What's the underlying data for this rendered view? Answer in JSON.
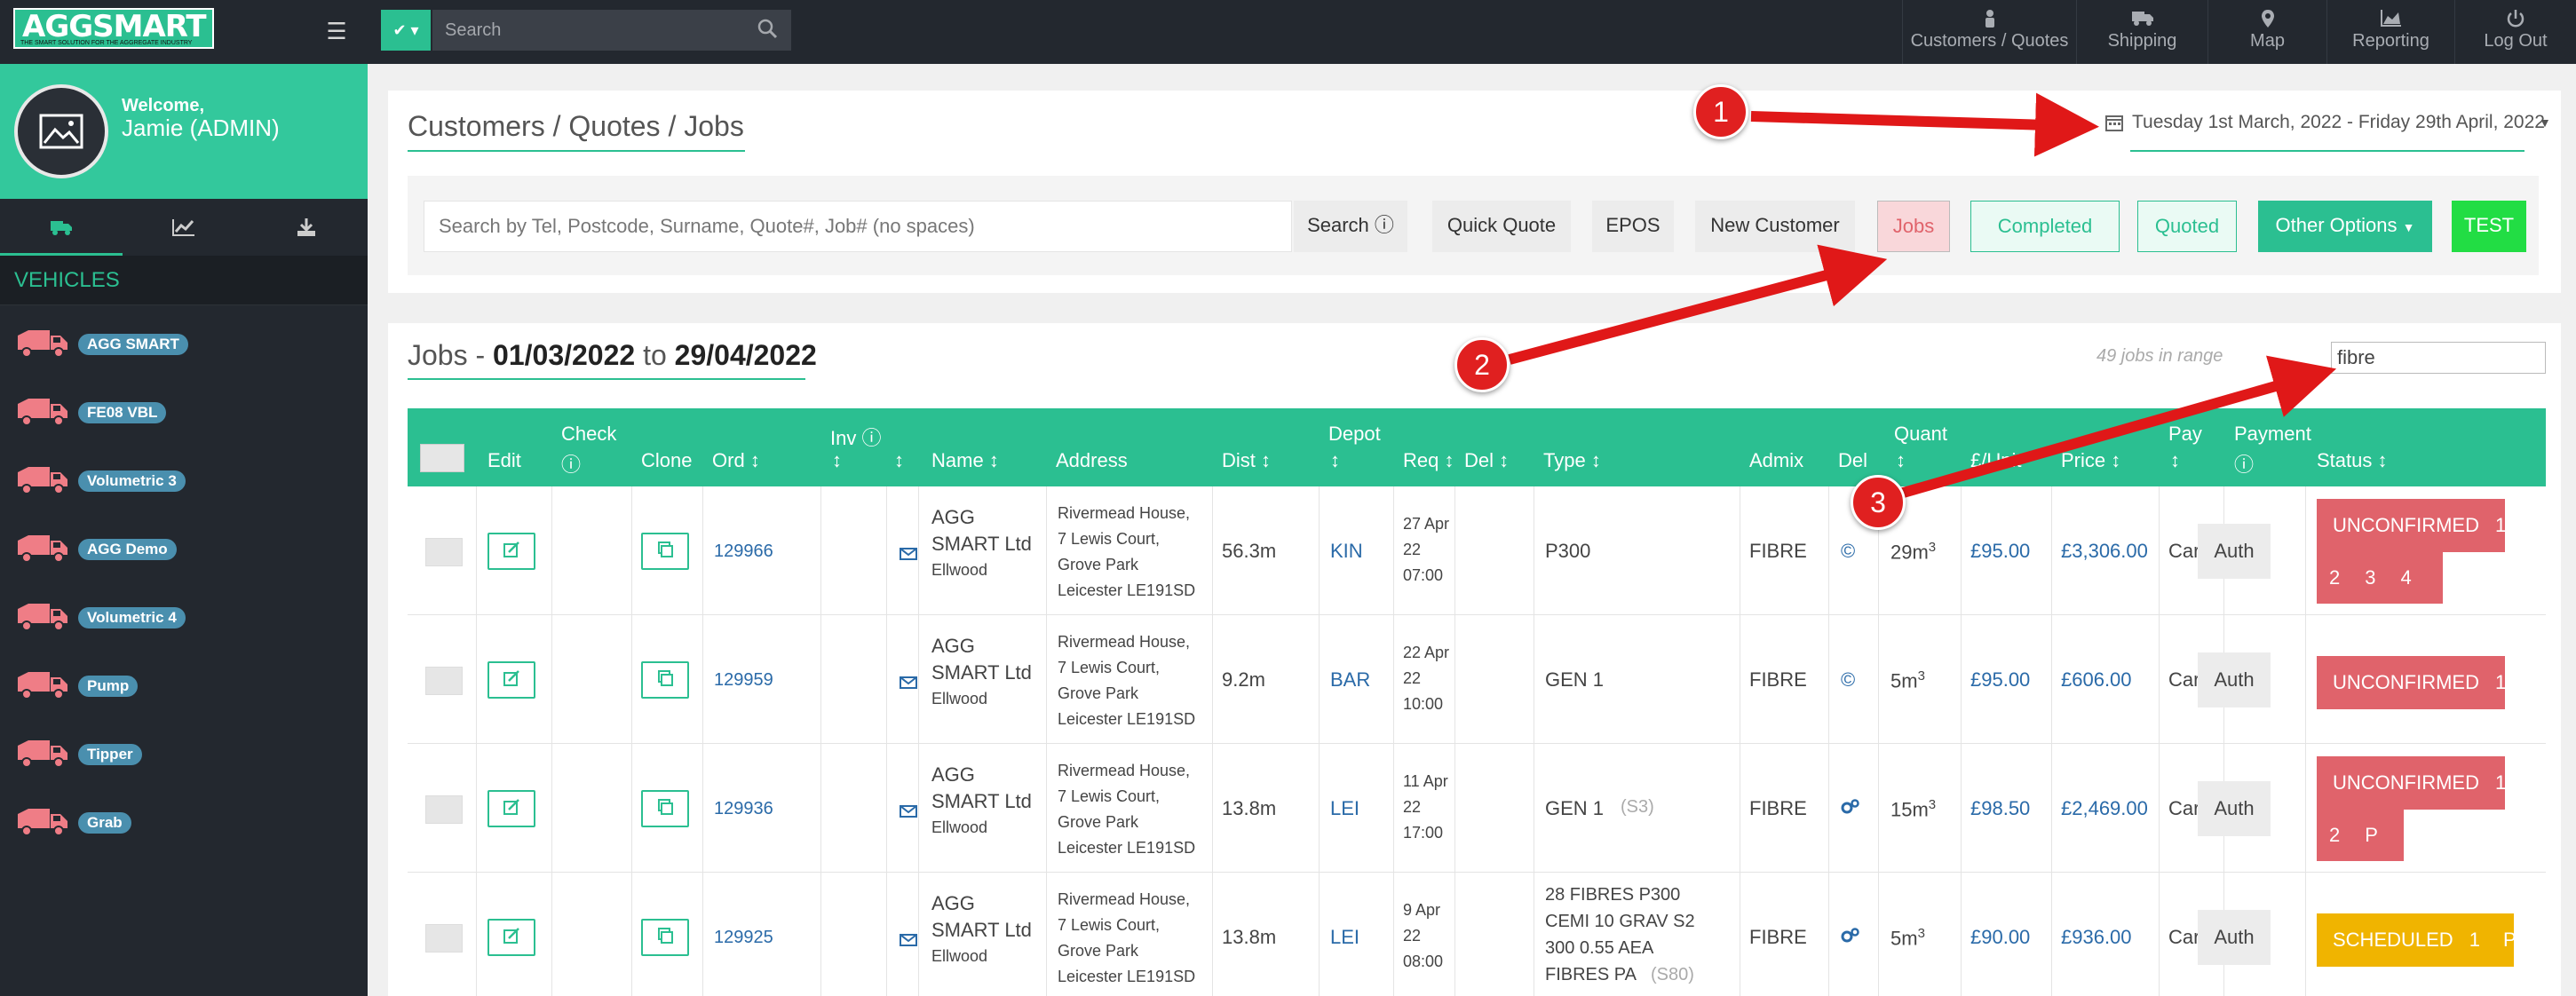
{
  "header": {
    "logo_text": "AGGSMART",
    "logo_tagline": "THE SMART SOLUTION FOR THE AGGREGATE INDUSTRY",
    "search_placeholder": "Search",
    "nav": [
      {
        "label": "Customers / Quotes",
        "icon": "person-icon"
      },
      {
        "label": "Shipping",
        "icon": "truck-icon"
      },
      {
        "label": "Map",
        "icon": "map-pin-icon"
      },
      {
        "label": "Reporting",
        "icon": "area-chart-icon"
      },
      {
        "label": "Log Out",
        "icon": "power-icon"
      }
    ]
  },
  "sidebar": {
    "welcome": "Welcome,",
    "user": "Jamie (ADMIN)",
    "section_title": "VEHICLES",
    "vehicles": [
      "AGG SMART",
      "FE08 VBL",
      "Volumetric 3",
      "AGG Demo",
      "Volumetric 4",
      "Pump",
      "Tipper",
      "Grab"
    ]
  },
  "panel": {
    "title": "Customers / Quotes / Jobs",
    "date_range": "Tuesday 1st March, 2022 - Friday 29th April, 2022",
    "search_placeholder": "Search by Tel, Postcode, Surname, Quote#, Job# (no spaces)",
    "buttons": {
      "search": "Search",
      "quick_quote": "Quick Quote",
      "epos": "EPOS",
      "new_customer": "New Customer",
      "jobs": "Jobs",
      "completed": "Completed",
      "quoted": "Quoted",
      "other_options": "Other Options",
      "test": "TEST"
    }
  },
  "jobs": {
    "title_prefix": "Jobs - ",
    "date_from": "01/03/2022",
    "to": " to ",
    "date_to": "29/04/2022",
    "count_text": "49 jobs in range",
    "filter_value": "fibre",
    "columns": {
      "edit": "Edit",
      "check": "Check",
      "clone": "Clone",
      "ord": "Ord",
      "inv": "Inv",
      "name": "Name",
      "address": "Address",
      "dist": "Dist",
      "depot": "Depot",
      "req": "Req",
      "del": "Del",
      "type": "Type",
      "admix": "Admix",
      "del2": "Del",
      "quant": "Quant",
      "unit": "£/Unit",
      "price": "Price",
      "pay": "Pay",
      "payment": "Payment",
      "status": "Status"
    },
    "rows": [
      {
        "ord": "129966",
        "name": [
          "AGG",
          "SMART Ltd"
        ],
        "name_sub": "Ellwood",
        "address": [
          "Rivermead House,",
          "7 Lewis Court,",
          "Grove Park",
          "Leicester LE191SD"
        ],
        "dist": "56.3m",
        "depot": "KIN",
        "req": [
          "27 Apr",
          "22",
          "07:00"
        ],
        "type": [
          "P300"
        ],
        "type_note": "",
        "admix": "FIBRE",
        "quant": "29m",
        "unit": "£95.00",
        "price": "£3,306.00",
        "pay": "Card",
        "payment": "Auth",
        "status": "UNCONFIRMED",
        "status_color": "#e0636b",
        "status_row1": [
          "1"
        ],
        "status_row2": [
          "2",
          "3",
          "4"
        ]
      },
      {
        "ord": "129959",
        "name": [
          "AGG",
          "SMART Ltd"
        ],
        "name_sub": "Ellwood",
        "address": [
          "Rivermead House,",
          "7 Lewis Court,",
          "Grove Park",
          "Leicester LE191SD"
        ],
        "dist": "9.2m",
        "depot": "BAR",
        "req": [
          "22 Apr",
          "22",
          "10:00"
        ],
        "type": [
          "GEN 1"
        ],
        "type_note": "",
        "admix": "FIBRE",
        "quant": "5m",
        "unit": "£95.00",
        "price": "£606.00",
        "pay": "Card",
        "payment": "Auth",
        "status": "UNCONFIRMED",
        "status_color": "#e0636b",
        "status_row1": [
          "1"
        ],
        "status_row2": []
      },
      {
        "ord": "129936",
        "name": [
          "AGG",
          "SMART Ltd"
        ],
        "name_sub": "Ellwood",
        "address": [
          "Rivermead House,",
          "7 Lewis Court,",
          "Grove Park",
          "Leicester LE191SD"
        ],
        "dist": "13.8m",
        "depot": "LEI",
        "req": [
          "11 Apr",
          "22",
          "17:00"
        ],
        "type": [
          "GEN 1"
        ],
        "type_note": "(S3)",
        "admix": "FIBRE",
        "quant": "15m",
        "unit": "£98.50",
        "price": "£2,469.00",
        "pay": "Card",
        "payment": "Auth",
        "status": "UNCONFIRMED",
        "status_color": "#e0636b",
        "status_row1": [
          "1"
        ],
        "status_row2": [
          "2",
          "P"
        ]
      },
      {
        "ord": "129925",
        "name": [
          "AGG",
          "SMART Ltd"
        ],
        "name_sub": "Ellwood",
        "address": [
          "Rivermead House,",
          "7 Lewis Court,",
          "Grove Park",
          "Leicester LE191SD"
        ],
        "dist": "13.8m",
        "depot": "LEI",
        "req": [
          "9 Apr",
          "22",
          "08:00"
        ],
        "type": [
          "28 FIBRES P300",
          "CEMI 10 GRAV S2",
          "300 0.55 AEA",
          "FIBRES PA"
        ],
        "type_note": "(S80)",
        "admix": "FIBRE",
        "quant": "5m",
        "unit": "£90.00",
        "price": "£936.00",
        "pay": "Card",
        "payment": "Auth",
        "status": "SCHEDULED",
        "status_color": "#f0b400",
        "status_row1": [
          "1",
          "P"
        ],
        "status_row2": []
      }
    ]
  },
  "annotations": [
    "1",
    "2",
    "3"
  ],
  "colors": {
    "accent": "#2bbf91",
    "dark": "#23282f",
    "unconfirmed": "#e0636b",
    "scheduled": "#f0b400",
    "test": "#22dd44",
    "arrow": "#e01818"
  }
}
